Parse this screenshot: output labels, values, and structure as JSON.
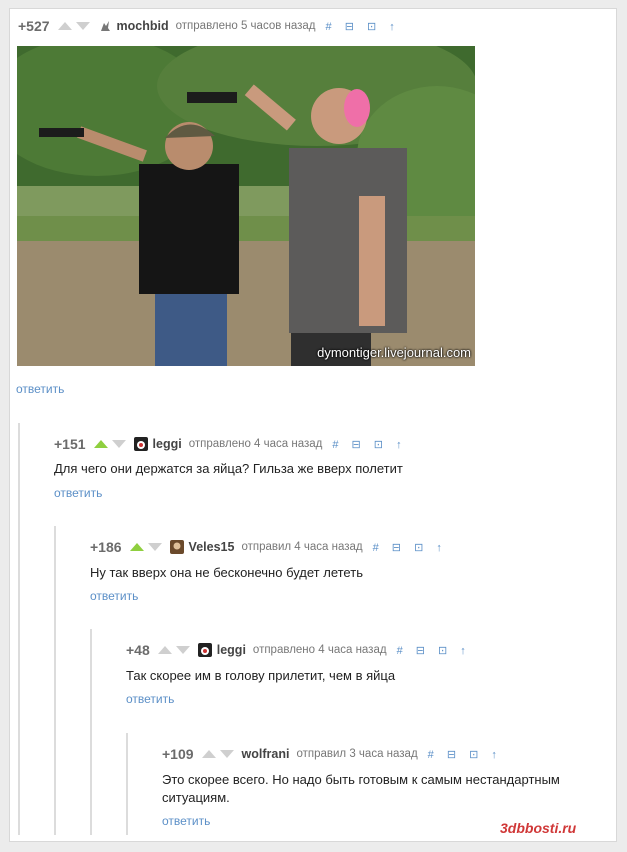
{
  "post": {
    "score": "+527",
    "user": "mochbid",
    "sent": "отправлено 5 часов назад",
    "action_icons": "# ⊟ ⊡ ↑",
    "watermark": "dymontiger.livejournal.com",
    "reply": "ответить"
  },
  "comments": [
    {
      "score": "+151",
      "user": "leggi",
      "sent": "отправлено 4 часа назад",
      "text": "Для чего они держатся за яйца? Гильза же вверх полетит",
      "reply": "ответить",
      "upvoted": true
    },
    {
      "score": "+186",
      "user": "Veles15",
      "sent": "отправил 4 часа назад",
      "text": "Ну так вверх она не бесконечно будет лететь",
      "reply": "ответить",
      "upvoted": true
    },
    {
      "score": "+48",
      "user": "leggi",
      "sent": "отправлено 4 часа назад",
      "text": "Так скорее им в голову прилетит, чем в яйца",
      "reply": "ответить",
      "upvoted": false
    },
    {
      "score": "+109",
      "user": "wolfrani",
      "sent": "отправил 3 часа назад",
      "text": "Это скорее всего. Но надо быть готовым к самым нестандартным ситуациям.",
      "reply": "ответить",
      "upvoted": false
    }
  ],
  "site_logo": "3dbbosti.ru",
  "icons": {
    "up": "upvote-arrow-icon",
    "down": "downvote-arrow-icon"
  },
  "colors": {
    "link": "#5b8fc7",
    "upvote_active": "#8fcf3f"
  }
}
